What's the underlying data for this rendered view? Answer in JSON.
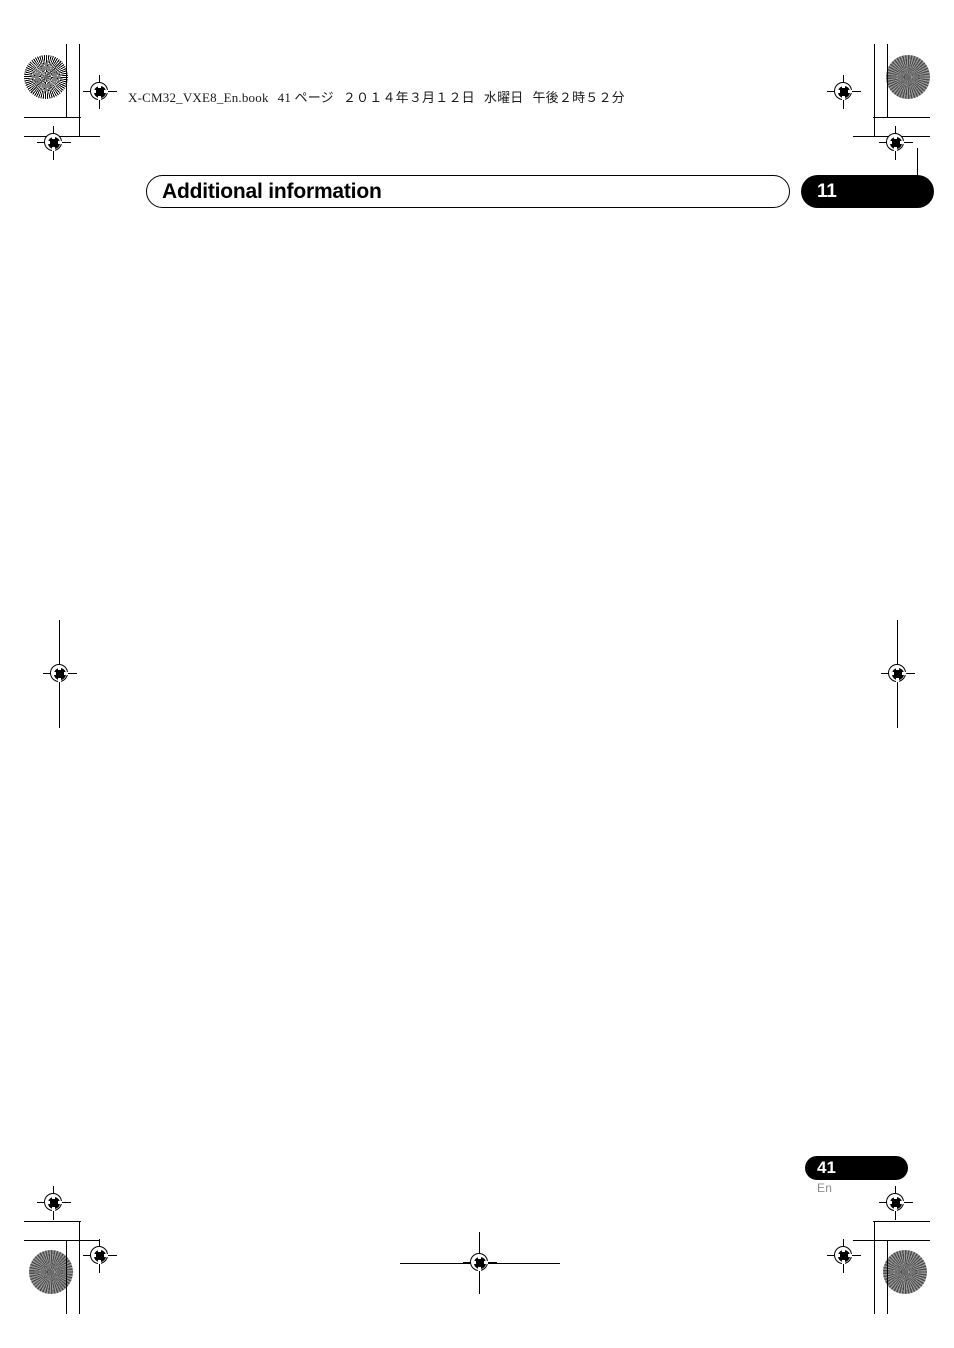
{
  "document": {
    "imposition_header": {
      "filename": "X-CM32_VXE8_En.book",
      "page_label": "41 ページ",
      "date": "２０１４年３月１２日",
      "weekday": "水曜日",
      "time": "午後２時５２分"
    },
    "chapter": {
      "title": "Additional information",
      "number": "11"
    },
    "body": {
      "content": ""
    },
    "footer": {
      "page_number": "41",
      "language_code": "En"
    },
    "colors": {
      "ink": "#000000",
      "paper": "#ffffff",
      "footer_lang": "#8c8c8c"
    }
  }
}
